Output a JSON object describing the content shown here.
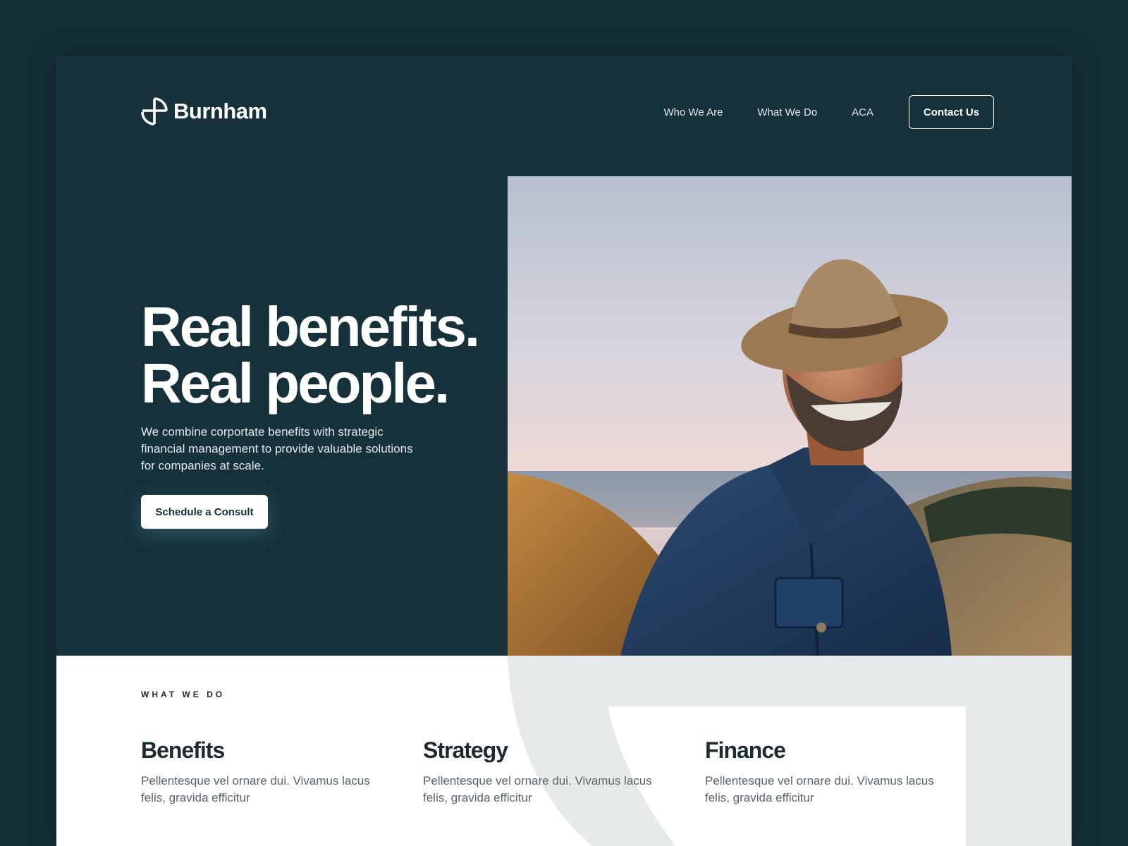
{
  "brand": {
    "name": "Burnham"
  },
  "nav": {
    "links": [
      "Who We Are",
      "What We Do",
      "ACA"
    ],
    "contact_label": "Contact Us"
  },
  "hero": {
    "headline_line1": "Real benefits.",
    "headline_line2": "Real people.",
    "subtext": "We combine corportate benefits with strategic financial management to provide valuable solutions for companies at scale.",
    "cta_label": "Schedule a Consult"
  },
  "what_we_do": {
    "label": "WHAT WE DO",
    "items": [
      {
        "title": "Benefits",
        "text": "Pellentesque vel ornare dui. Vivamus lacus felis, gravida efficitur"
      },
      {
        "title": "Strategy",
        "text": "Pellentesque vel ornare dui. Vivamus lacus felis, gravida efficitur"
      },
      {
        "title": "Finance",
        "text": "Pellentesque vel ornare dui. Vivamus lacus felis, gravida efficitur"
      }
    ]
  },
  "colors": {
    "page_bg": "#142f36",
    "hero_bg": "#16313a",
    "accent_light": "#e6eaea",
    "button_bg": "#ffffff"
  },
  "icons": {
    "logo": "burnham-logo-mark-icon"
  }
}
